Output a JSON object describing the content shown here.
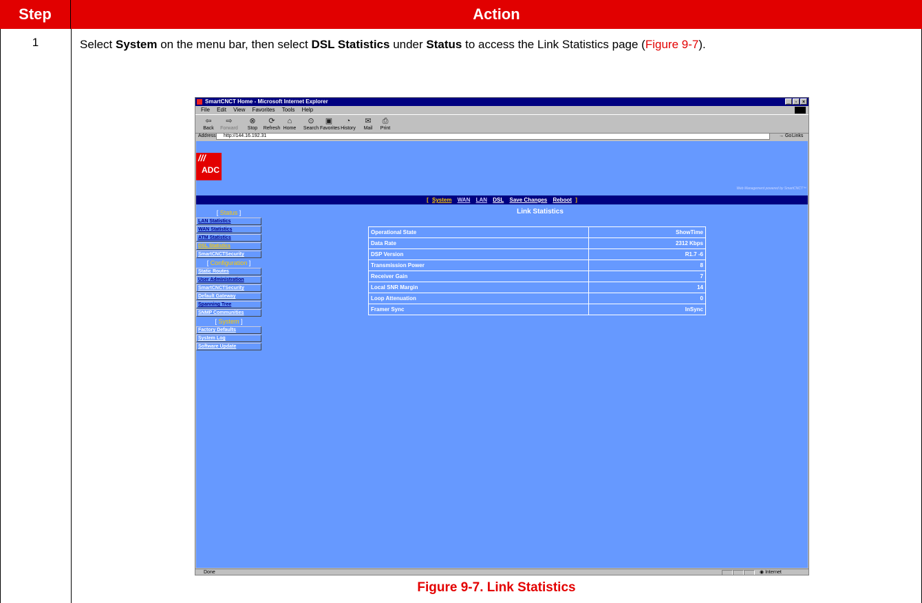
{
  "table": {
    "header_step": "Step",
    "header_action": "Action",
    "step_number": "1",
    "instruction": {
      "p1": "Select ",
      "b1": "System",
      "p2": " on the menu bar, then select ",
      "b2": "DSL Statistics",
      "p3": " under ",
      "b3": "Status",
      "p4": " to access the Link Statistics page (",
      "figure_ref": "Figure 9-7",
      "p5": ")."
    },
    "caption": "Figure 9-7. Link Statistics"
  },
  "browser": {
    "title": "SmartCNCT Home - Microsoft Internet Explorer",
    "menu": [
      "File",
      "Edit",
      "View",
      "Favorites",
      "Tools",
      "Help"
    ],
    "toolbar": [
      "Back",
      "Forward",
      "Stop",
      "Refresh",
      "Home",
      "Search",
      "Favorites",
      "History",
      "Mail",
      "Print"
    ],
    "address_label": "Address",
    "address_value": "http://144.16.192.31",
    "go_label": "Go",
    "links_label": "Links",
    "status_text": "Done",
    "zone_text": "Internet"
  },
  "app": {
    "logo_text": "ADC",
    "powered_by": "Web Management powered by SmartCNCT™",
    "nav": [
      "System",
      "WAN",
      "LAN",
      "DSL",
      "Save Changes",
      "Reboot"
    ],
    "sections": [
      {
        "title": "Status",
        "items": [
          "LAN Statistics",
          "WAN Statistics",
          "ATM Statistics",
          "DSL Statistics",
          "SmartCNCTSecurity"
        ]
      },
      {
        "title": "Configuration",
        "items": [
          "Static Routes",
          "User Administration",
          "SmartCNCTSecurity",
          "Default Gateway",
          "Spanning Tree",
          "SNMP Communities"
        ]
      },
      {
        "title": "System",
        "items": [
          "Factory Defaults",
          "System Log",
          "Software Update"
        ]
      }
    ],
    "page_title": "Link Statistics",
    "stats": [
      {
        "label": "Operational State",
        "value": "ShowTime"
      },
      {
        "label": "Data Rate",
        "value": "2312 Kbps"
      },
      {
        "label": "DSP Version",
        "value": "R1.7 -6"
      },
      {
        "label": "Transmission Power",
        "value": "8"
      },
      {
        "label": "Receiver Gain",
        "value": "7"
      },
      {
        "label": "Local SNR Margin",
        "value": "14"
      },
      {
        "label": "Loop Attenuation",
        "value": "0"
      },
      {
        "label": "Framer Sync",
        "value": "InSync"
      }
    ]
  }
}
